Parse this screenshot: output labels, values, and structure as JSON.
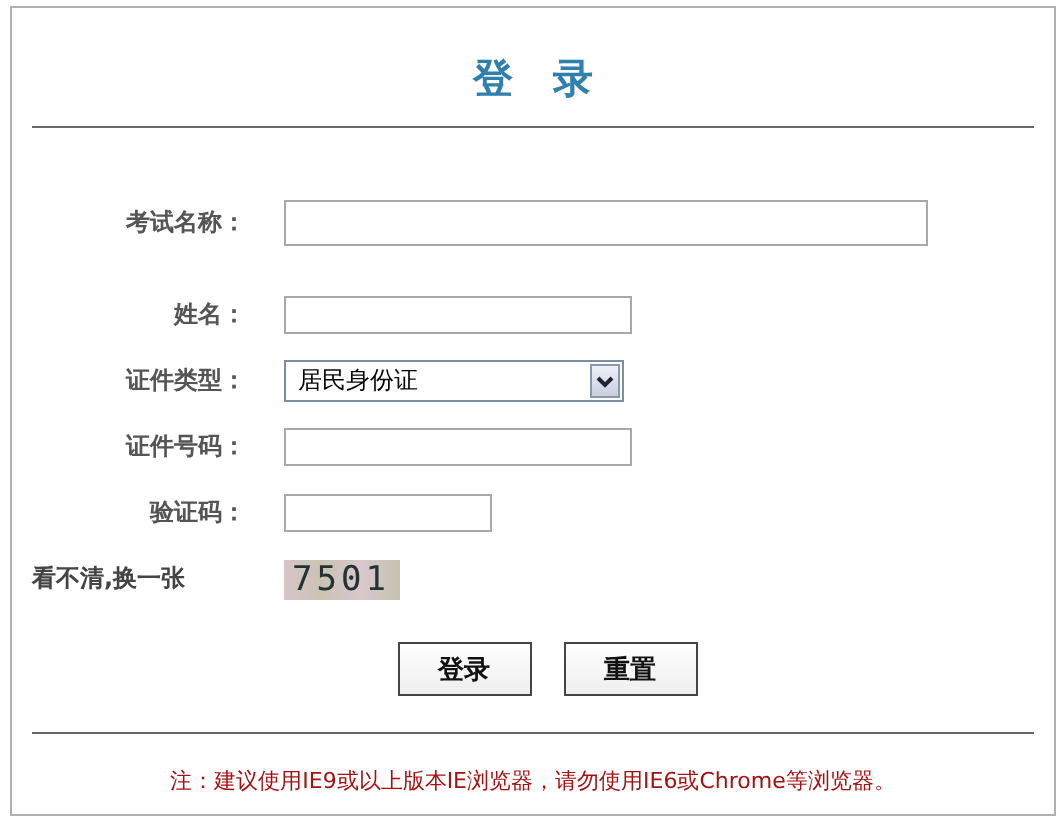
{
  "title": "登　录",
  "fields": [
    {
      "label": "考试名称：",
      "kind": "wide"
    },
    {
      "label": "姓名：",
      "kind": "text"
    },
    {
      "label": "证件类型：",
      "kind": "select",
      "value": "居民身份证"
    },
    {
      "label": "证件号码：",
      "kind": "text"
    },
    {
      "label": "验证码：",
      "kind": "captcha"
    }
  ],
  "captcha": {
    "link": "看不清,换一张",
    "code": "7501"
  },
  "buttons": [
    "登录",
    "重置"
  ],
  "note": "注：建议使用IE9或以上版本IE浏览器，请勿使用IE6或Chrome等浏览器。"
}
